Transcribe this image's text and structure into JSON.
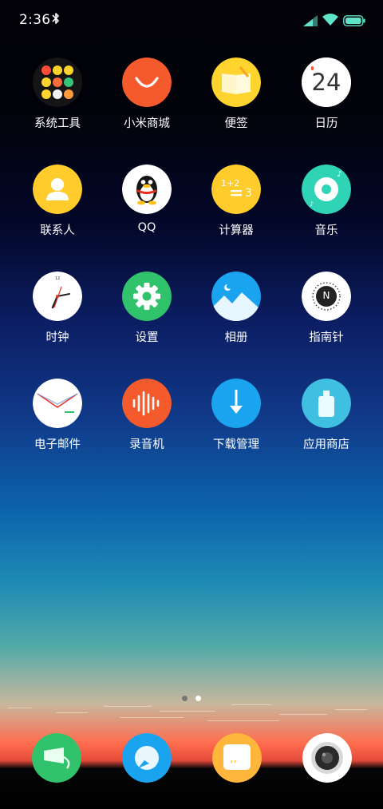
{
  "status_bar": {
    "time": "2:36",
    "icons": [
      "bluetooth-icon",
      "cellular-signal-icon",
      "wifi-icon",
      "battery-icon"
    ]
  },
  "home": {
    "apps": [
      {
        "label": "系统工具",
        "icon": "system-tools-folder-icon"
      },
      {
        "label": "小米商城",
        "icon": "mi-store-icon"
      },
      {
        "label": "便签",
        "icon": "notes-icon"
      },
      {
        "label": "日历",
        "icon": "calendar-icon",
        "badge": "24"
      },
      {
        "label": "联系人",
        "icon": "contacts-icon"
      },
      {
        "label": "QQ",
        "icon": "qq-penguin-icon"
      },
      {
        "label": "计算器",
        "icon": "calculator-icon",
        "formula": "1+2",
        "result": "3"
      },
      {
        "label": "音乐",
        "icon": "music-icon"
      },
      {
        "label": "时钟",
        "icon": "clock-icon"
      },
      {
        "label": "设置",
        "icon": "gear-icon"
      },
      {
        "label": "相册",
        "icon": "gallery-icon"
      },
      {
        "label": "指南针",
        "icon": "compass-icon",
        "letter": "N"
      },
      {
        "label": "电子邮件",
        "icon": "email-icon"
      },
      {
        "label": "录音机",
        "icon": "recorder-icon"
      },
      {
        "label": "下载管理",
        "icon": "download-icon"
      },
      {
        "label": "应用商店",
        "icon": "app-store-icon"
      }
    ]
  },
  "page_indicator": {
    "pages": 2,
    "current": 2
  },
  "dock": [
    {
      "icon": "phone-icon"
    },
    {
      "icon": "browser-icon"
    },
    {
      "icon": "messages-icon"
    },
    {
      "icon": "camera-icon"
    }
  ],
  "colors": {
    "mi_orange": "#f55a2c",
    "yellow": "#ffcc2b",
    "teal": "#2fd3b5",
    "green": "#31c36b",
    "blue": "#1aa4f0"
  }
}
